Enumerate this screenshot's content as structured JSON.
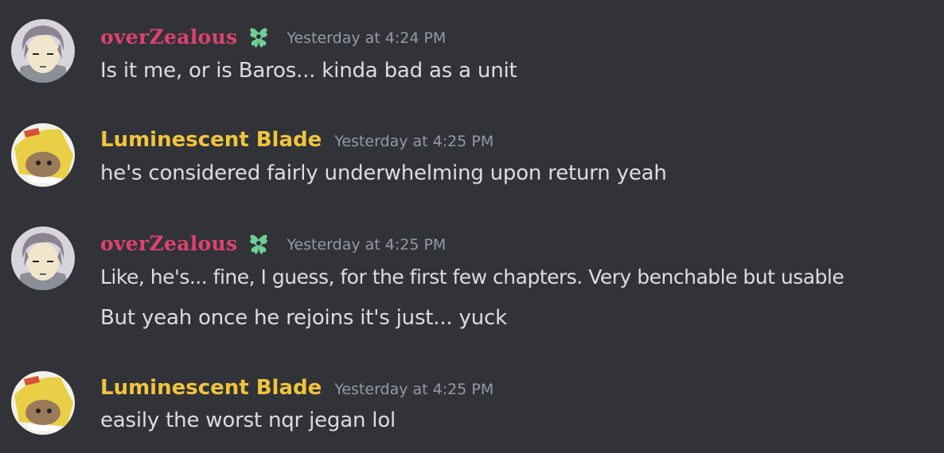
{
  "theme": {
    "background": "#313338",
    "text": "#dbdee1",
    "timestamp": "#949ba4"
  },
  "users": {
    "overzealous": {
      "name": "overZealous",
      "color": "#e0416e",
      "role_icon": "green-flower-role-icon",
      "avatar": "anime-boy-gray-hair-avatar"
    },
    "luminescent": {
      "name": "Luminescent Blade",
      "color": "#f0c43c",
      "avatar": "hamster-in-chip-bag-avatar"
    }
  },
  "messages": [
    {
      "author": "overZealous",
      "timestamp": "Yesterday at 4:24 PM",
      "lines": [
        "Is it me, or is Baros... kinda bad as a unit"
      ]
    },
    {
      "author": "Luminescent Blade",
      "timestamp": "Yesterday at 4:25 PM",
      "lines": [
        "he's considered fairly underwhelming upon return yeah"
      ]
    },
    {
      "author": "overZealous",
      "timestamp": "Yesterday at 4:25 PM",
      "lines": [
        "Like, he's... fine, I guess, for the first few chapters. Very benchable but usable",
        "But yeah once he rejoins it's just... yuck"
      ]
    },
    {
      "author": "Luminescent Blade",
      "timestamp": "Yesterday at 4:25 PM",
      "lines": [
        "easily the worst nqr jegan lol"
      ]
    }
  ]
}
